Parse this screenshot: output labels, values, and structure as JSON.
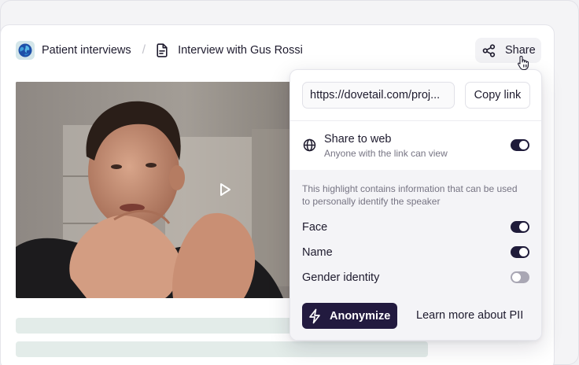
{
  "breadcrumb": {
    "project": "Patient interviews",
    "separator": "/",
    "document": "Interview with Gus Rossi"
  },
  "share_button": {
    "label": "Share"
  },
  "share_popover": {
    "url": "https://dovetail.com/proj...",
    "copy_label": "Copy link",
    "share_to_web": {
      "title": "Share to web",
      "subtitle": "Anyone with the link can view",
      "enabled": true
    },
    "pii_description": "This highlight contains information that can be used to personally identify the speaker",
    "pii_items": [
      {
        "label": "Face",
        "enabled": true
      },
      {
        "label": "Name",
        "enabled": true
      },
      {
        "label": "Gender identity",
        "enabled": false
      }
    ],
    "anonymize_label": "Anonymize",
    "learn_more_label": "Learn more about PII"
  },
  "icons": {
    "project": "globe-logo-icon",
    "document": "document-icon",
    "share": "share-icon",
    "web": "globe-icon",
    "play": "play-icon",
    "anonymize": "lightning-icon",
    "cursor": "hand-cursor-icon"
  },
  "colors": {
    "accent_dark": "#221a3f",
    "toggle_on": "#1f1b3a",
    "toggle_off": "#a9a7b4",
    "skeleton": "#e3ece9"
  }
}
